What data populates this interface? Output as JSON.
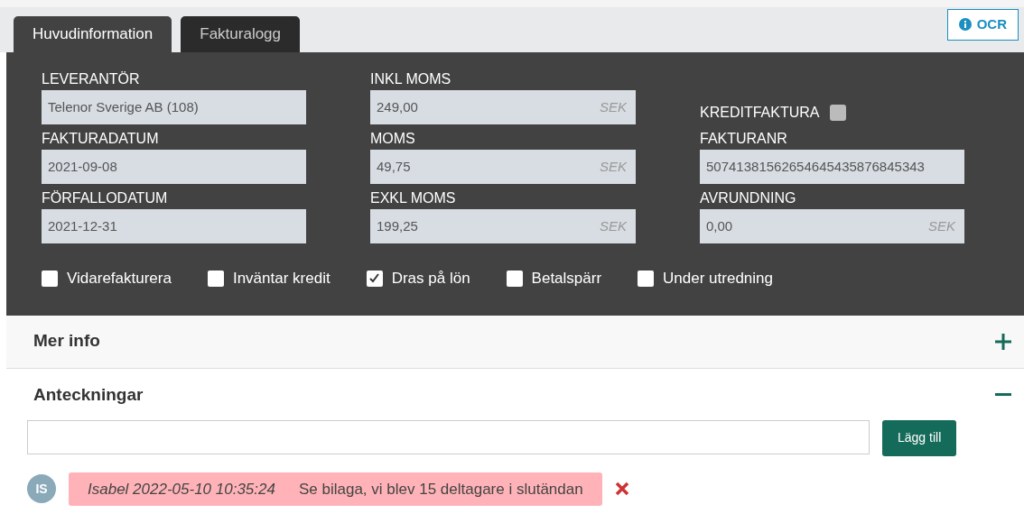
{
  "tabs": [
    {
      "label": "Huvudinformation",
      "selected": true
    },
    {
      "label": "Fakturalogg",
      "selected": false
    }
  ],
  "ocr_button": {
    "label": "OCR"
  },
  "fields": [
    {
      "kind": "text",
      "label": "LEVERANTÖR",
      "value": "Telenor Sverige AB (108)"
    },
    {
      "kind": "currency",
      "label": "INKL MOMS",
      "value": "249,00",
      "unit": "SEK"
    },
    {
      "kind": "checkbox",
      "label": "KREDITFAKTURA",
      "checked": false,
      "disabled": true
    },
    {
      "kind": "text",
      "label": "FAKTURADATUM",
      "value": "2021-09-08"
    },
    {
      "kind": "currency",
      "label": "MOMS",
      "value": "49,75",
      "unit": "SEK"
    },
    {
      "kind": "text",
      "label": "FAKTURANR",
      "value": "50741381562654645435876845343"
    },
    {
      "kind": "text",
      "label": "FÖRFALLODATUM",
      "value": "2021-12-31"
    },
    {
      "kind": "currency",
      "label": "EXKL MOMS",
      "value": "199,25",
      "unit": "SEK"
    },
    {
      "kind": "currency",
      "label": "AVRUNDNING",
      "value": "0,00",
      "unit": "SEK"
    }
  ],
  "options": [
    {
      "label": "Vidarefakturera",
      "checked": false
    },
    {
      "label": "Inväntar kredit",
      "checked": false
    },
    {
      "label": "Dras på lön",
      "checked": true
    },
    {
      "label": "Betalspärr",
      "checked": false
    },
    {
      "label": "Under utredning",
      "checked": false
    }
  ],
  "sections": [
    {
      "title": "Mer info",
      "expanded": false
    },
    {
      "title": "Anteckningar",
      "expanded": true
    }
  ],
  "notes_form": {
    "button": "Lägg till"
  },
  "notes": [
    {
      "initials": "IS",
      "meta": "Isabel 2022-05-10 10:35:24",
      "text": "Se bilaga, vi blev 15 deltagare i slutändan"
    }
  ]
}
